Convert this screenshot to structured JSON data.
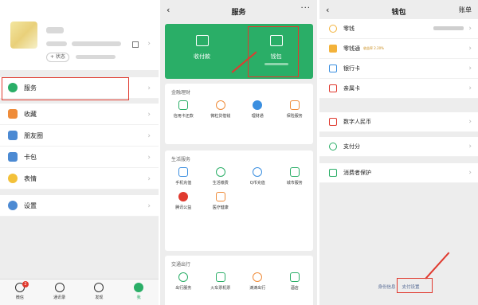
{
  "me_panel": {
    "status_label": "+ 状态",
    "menu_groups": [
      [
        {
          "label": "服务",
          "icon": "service-icon",
          "color": "#2aae67"
        }
      ],
      [
        {
          "label": "收藏",
          "icon": "favorites-icon",
          "color": "#ef8c3a"
        },
        {
          "label": "朋友圈",
          "icon": "moments-icon",
          "color": "#4c8ad3"
        },
        {
          "label": "卡包",
          "icon": "card-pack-icon",
          "color": "#4c8ad3"
        },
        {
          "label": "表情",
          "icon": "sticker-icon",
          "color": "#f3c13a"
        }
      ],
      [
        {
          "label": "设置",
          "icon": "settings-icon",
          "color": "#4c8ad3"
        }
      ]
    ],
    "tabs": [
      {
        "label": "微信",
        "icon": "chat-icon",
        "badge": "2"
      },
      {
        "label": "通讯录",
        "icon": "contacts-icon"
      },
      {
        "label": "发现",
        "icon": "discover-icon"
      },
      {
        "label": "我",
        "icon": "me-icon"
      }
    ]
  },
  "services_panel": {
    "title": "服务",
    "more": "···",
    "cards": [
      {
        "label": "收付款",
        "icon": "pay-receive-icon"
      },
      {
        "label": "钱包",
        "icon": "wallet-icon"
      }
    ],
    "sections": [
      {
        "title": "金融理财",
        "items": [
          {
            "label": "信用卡还款",
            "icon": "credit-card-icon",
            "color": "#2aae67"
          },
          {
            "label": "微粒贷借钱",
            "icon": "loan-icon",
            "color": "#ef8c3a"
          },
          {
            "label": "理财通",
            "icon": "wealth-icon",
            "color": "#3b8fe0"
          },
          {
            "label": "保险服务",
            "icon": "insurance-icon",
            "color": "#ef8c3a"
          }
        ]
      },
      {
        "title": "生活服务",
        "items": [
          {
            "label": "手机充值",
            "icon": "mobile-topup-icon",
            "color": "#3b8fe0"
          },
          {
            "label": "生活缴费",
            "icon": "utility-icon",
            "color": "#2aae67"
          },
          {
            "label": "Q币充值",
            "icon": "qcoin-icon",
            "color": "#3b8fe0"
          },
          {
            "label": "城市服务",
            "icon": "city-icon",
            "color": "#2aae67"
          },
          {
            "label": "腾讯公益",
            "icon": "charity-icon",
            "color": "#e03a2f"
          },
          {
            "label": "医疗健康",
            "icon": "health-icon",
            "color": "#ef8c3a"
          }
        ]
      },
      {
        "title": "交通出行",
        "items": [
          {
            "label": "出行服务",
            "icon": "travel-icon",
            "color": "#2aae67"
          },
          {
            "label": "火车票机票",
            "icon": "train-icon",
            "color": "#2aae67"
          },
          {
            "label": "滴滴出行",
            "icon": "didi-icon",
            "color": "#ef8c3a"
          },
          {
            "label": "酒店",
            "icon": "hotel-icon",
            "color": "#2aae67"
          }
        ]
      }
    ]
  },
  "wallet_panel": {
    "title": "钱包",
    "bill_label": "账单",
    "groups": [
      [
        {
          "label": "零钱",
          "icon": "change-icon",
          "color": "#f3b23a",
          "masked_value": true
        },
        {
          "label": "零钱通",
          "tag": "收益率 2.20%",
          "icon": "change-plus-icon",
          "color": "#f3b23a"
        },
        {
          "label": "银行卡",
          "icon": "bank-card-icon",
          "color": "#3b8fe0"
        },
        {
          "label": "亲属卡",
          "icon": "family-card-icon",
          "color": "#e03a2f"
        }
      ],
      [
        {
          "label": "数字人民币",
          "icon": "ecny-icon",
          "color": "#e03a2f"
        }
      ],
      [
        {
          "label": "支付分",
          "icon": "pay-score-icon",
          "color": "#2aae67"
        }
      ],
      [
        {
          "label": "消费者保护",
          "icon": "consumer-protect-icon",
          "color": "#2aae67"
        }
      ]
    ],
    "footer": {
      "identity": "身份信息",
      "pay_settings": "支付设置"
    }
  },
  "highlight_color": "#e03a2f"
}
